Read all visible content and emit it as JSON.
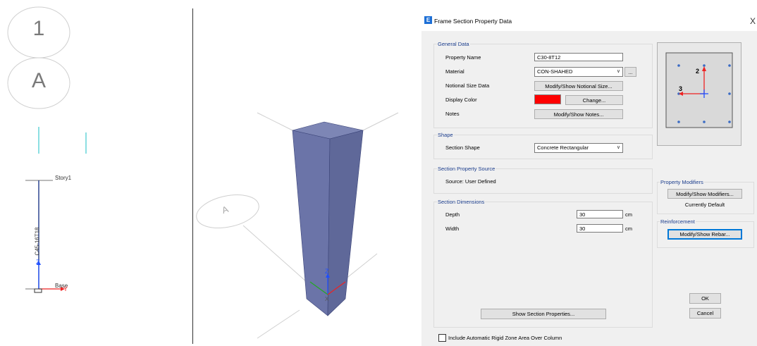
{
  "left_view": {
    "grid_bubble_1": "1",
    "grid_bubble_a": "A",
    "story_label": "Story1",
    "base_label": "Base",
    "column_label": "C45-16T18",
    "axis_z": "Z",
    "axis_y": "Y"
  },
  "view3d": {
    "grid_bubble": "A",
    "axis_z": "Z",
    "axis_x": "X"
  },
  "dialog": {
    "title": "Frame Section Property Data",
    "logo": "E",
    "close": "X",
    "general": {
      "title": "General Data",
      "property_name_label": "Property Name",
      "property_name_value": "C30-8T12",
      "material_label": "Material",
      "material_value": "CON-SHAHED",
      "material_more": "...",
      "notional_label": "Notional Size Data",
      "notional_button": "Modify/Show Notional Size...",
      "display_color_label": "Display Color",
      "display_color_value": "#ff0000",
      "change_button": "Change...",
      "notes_label": "Notes",
      "notes_button": "Modify/Show Notes..."
    },
    "shape": {
      "title": "Shape",
      "section_shape_label": "Section Shape",
      "section_shape_value": "Concrete Rectangular"
    },
    "source": {
      "title": "Section Property Source",
      "source_text": "Source:  User Defined"
    },
    "dimensions": {
      "title": "Section Dimensions",
      "depth_label": "Depth",
      "depth_value": "30",
      "depth_unit": "cm",
      "width_label": "Width",
      "width_value": "30",
      "width_unit": "cm",
      "show_properties_button": "Show Section Properties..."
    },
    "preview": {
      "axis_2": "2",
      "axis_3": "3"
    },
    "modifiers": {
      "title": "Property Modifiers",
      "button": "Modify/Show Modifiers...",
      "status": "Currently Default"
    },
    "reinforcement": {
      "title": "Reinforcement",
      "button": "Modify/Show Rebar..."
    },
    "ok_button": "OK",
    "cancel_button": "Cancel",
    "rigid_zone_label": "Include Automatic Rigid Zone Area Over Column"
  }
}
